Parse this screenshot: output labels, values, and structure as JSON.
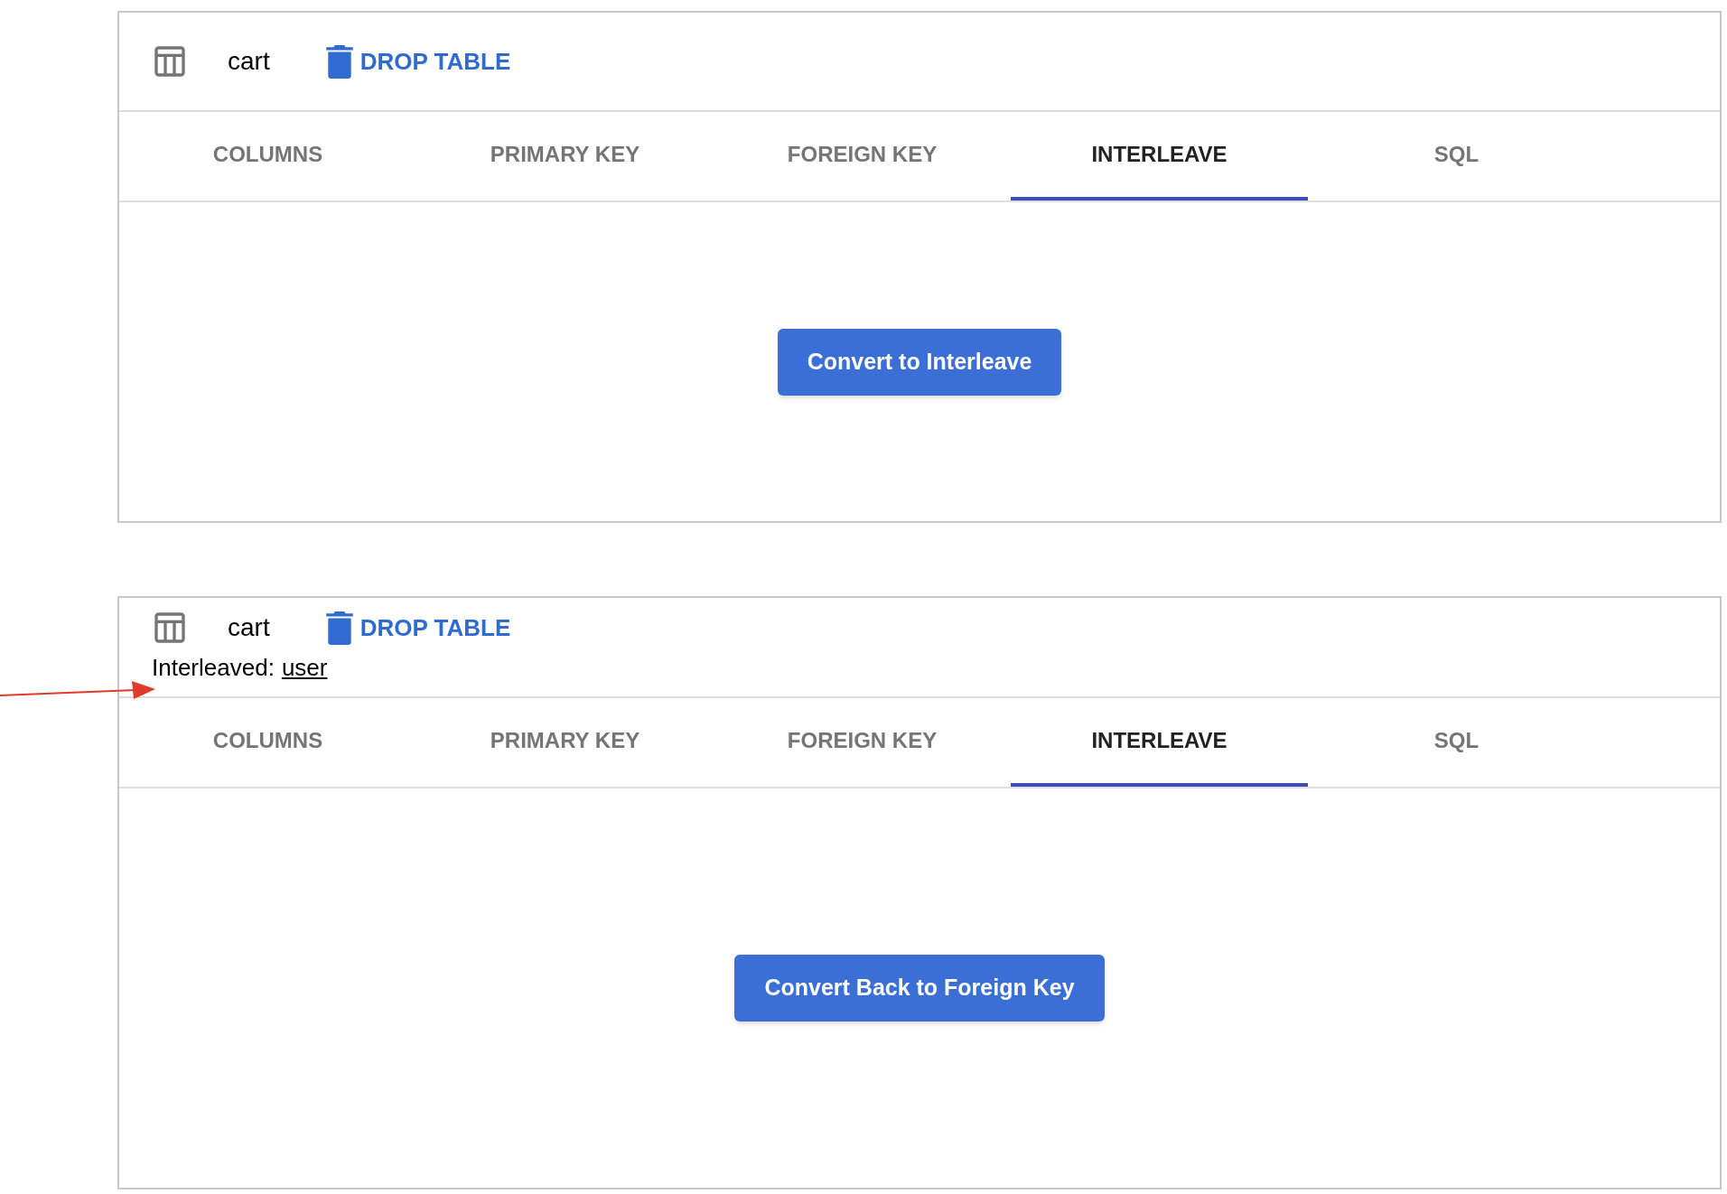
{
  "panels": [
    {
      "table_name": "cart",
      "drop_button": "DROP TABLE",
      "tabs": [
        {
          "label": "COLUMNS",
          "selected": false
        },
        {
          "label": "PRIMARY KEY",
          "selected": false
        },
        {
          "label": "FOREIGN KEY",
          "selected": false
        },
        {
          "label": "INTERLEAVE",
          "selected": true
        },
        {
          "label": "SQL",
          "selected": false
        }
      ],
      "action_button": "Convert to Interleave"
    },
    {
      "table_name": "cart",
      "drop_button": "DROP TABLE",
      "interleaved": {
        "label": "Interleaved:",
        "parent": "user"
      },
      "tabs": [
        {
          "label": "COLUMNS",
          "selected": false
        },
        {
          "label": "PRIMARY KEY",
          "selected": false
        },
        {
          "label": "FOREIGN KEY",
          "selected": false
        },
        {
          "label": "INTERLEAVE",
          "selected": true
        },
        {
          "label": "SQL",
          "selected": false
        }
      ],
      "action_button": "Convert Back to Foreign Key"
    }
  ]
}
